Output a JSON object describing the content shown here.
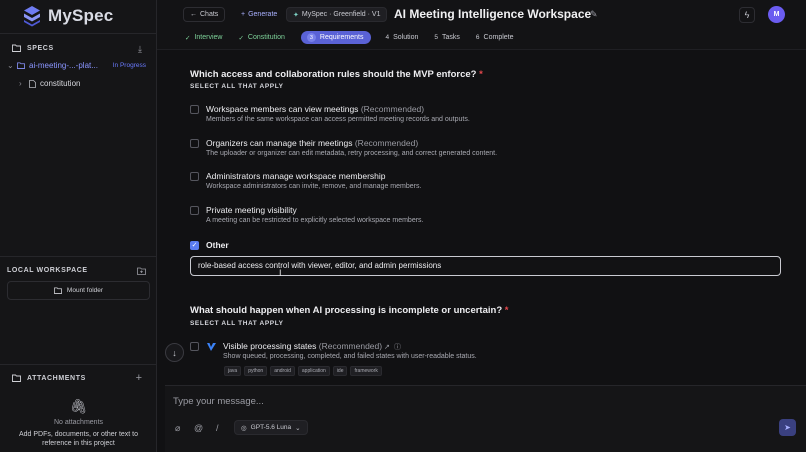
{
  "app": {
    "name": "MySpec"
  },
  "sidebar": {
    "specs_label": "SPECS",
    "items": [
      {
        "label": "ai-meeting-...-plat...",
        "status": "In Progress"
      },
      {
        "label": "constitution"
      }
    ],
    "local_workspace_label": "LOCAL WORKSPACE",
    "mount_label": "Mount folder",
    "attachments_label": "ATTACHMENTS",
    "no_attachments": "No attachments",
    "attachments_hint": "Add PDFs, documents, or other text to reference in this project"
  },
  "header": {
    "chats_label": "Chats",
    "generate_label": "Generate",
    "project_label": "MySpec · Greenfield · V1",
    "title": "AI Meeting Intelligence Workspace",
    "avatar": "M",
    "steps": [
      {
        "num": "✓",
        "label": "Interview"
      },
      {
        "num": "✓",
        "label": "Constitution"
      },
      {
        "num": "3",
        "label": "Requirements"
      },
      {
        "num": "4",
        "label": "Solution"
      },
      {
        "num": "5",
        "label": "Tasks"
      },
      {
        "num": "6",
        "label": "Complete"
      }
    ]
  },
  "main": {
    "q1": {
      "title": "Which access and collaboration rules should the MVP enforce?",
      "required_mark": "*",
      "subtitle": "SELECT ALL THAT APPLY",
      "options": [
        {
          "label": "Workspace members can view meetings",
          "rec": "(Recommended)",
          "desc": "Members of the same workspace can access permitted meeting records and outputs.",
          "checked": false
        },
        {
          "label": "Organizers can manage their meetings",
          "rec": "(Recommended)",
          "desc": "The uploader or organizer can edit metadata, retry processing, and correct generated content.",
          "checked": false
        },
        {
          "label": "Administrators manage workspace membership",
          "rec": "",
          "desc": "Workspace administrators can invite, remove, and manage members.",
          "checked": false
        },
        {
          "label": "Private meeting visibility",
          "rec": "",
          "desc": "A meeting can be restricted to explicitly selected workspace members.",
          "checked": false
        }
      ],
      "other_label": "Other",
      "other_checked": true,
      "other_value": "role-based access control with viewer, editor, and admin permissions"
    },
    "q2": {
      "title": "What should happen when AI processing is incomplete or uncertain?",
      "required_mark": "*",
      "subtitle": "SELECT ALL THAT APPLY",
      "option": {
        "label": "Visible processing states",
        "rec": "(Recommended)",
        "desc": "Show queued, processing, completed, and failed states with user-readable status.",
        "checked": false
      },
      "tags": [
        "java",
        "python",
        "android",
        "application",
        "ide",
        "framework"
      ]
    }
  },
  "composer": {
    "placeholder": "Type your message...",
    "model_label": "GPT-5.6 Luna"
  }
}
